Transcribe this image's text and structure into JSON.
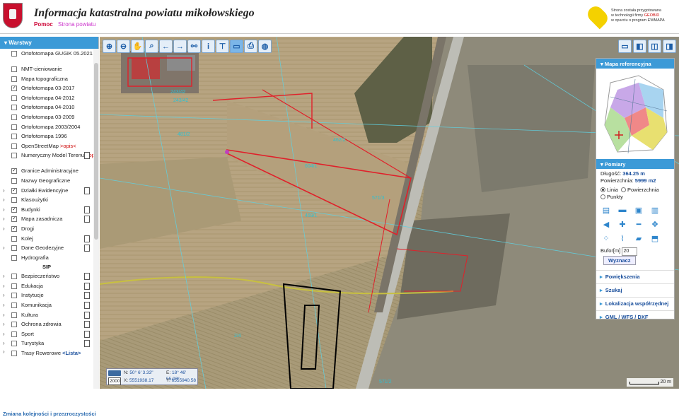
{
  "header": {
    "title": "Informacja katastralna powiatu mikołowskiego",
    "help_link": "Pomoc",
    "home_link": "Strona powiatu",
    "geobid_line1": "Strona została przygotowana",
    "geobid_line2a": "w technologii firmy ",
    "geobid_brand": "GEOBID",
    "geobid_line3": "w oparciu o program EWMAPA"
  },
  "layers_panel": {
    "title": "Warstwy",
    "items": [
      {
        "label": "Ortofotomapa GUGiK 05.2021",
        "checked": false,
        "expand": false,
        "doc": false,
        "two": true
      },
      {
        "label": "NMT-cieniowanie",
        "checked": false,
        "expand": false,
        "doc": false
      },
      {
        "label": "Mapa topograficzna",
        "checked": false,
        "expand": false,
        "doc": false
      },
      {
        "label": "Ortofotomapa 03-2017",
        "checked": true,
        "expand": false,
        "doc": false
      },
      {
        "label": "Ortofotomapa 04-2012",
        "checked": false,
        "expand": false,
        "doc": false
      },
      {
        "label": "Ortofotomapa 04-2010",
        "checked": false,
        "expand": false,
        "doc": false
      },
      {
        "label": "Ortofotomapa 03-2009",
        "checked": false,
        "expand": false,
        "doc": false
      },
      {
        "label": "Ortofotomapa 2003/2004",
        "checked": false,
        "expand": false,
        "doc": false
      },
      {
        "label": "Ortofotomapa 1996",
        "checked": false,
        "expand": false,
        "doc": false
      },
      {
        "label": "OpenStreetMap ",
        "opis": ">opis<",
        "checked": false,
        "expand": false,
        "doc": false
      },
      {
        "label": "Numeryczny Model Terenu ",
        "opis": ">opis<",
        "checked": false,
        "expand": false,
        "doc": true,
        "two": true
      },
      {
        "label": "Granice Administracyjne",
        "checked": true,
        "expand": false,
        "doc": false
      },
      {
        "label": "Nazwy Geograficzne",
        "checked": false,
        "expand": false,
        "doc": false
      },
      {
        "label": "Działki Ewidencyjne",
        "checked": true,
        "expand": true,
        "doc": true
      },
      {
        "label": "Klasoużytki",
        "checked": false,
        "expand": true,
        "doc": false
      },
      {
        "label": "Budynki",
        "checked": true,
        "expand": true,
        "doc": true
      },
      {
        "label": "Mapa zasadnicza",
        "checked": true,
        "expand": true,
        "doc": true
      },
      {
        "label": "Drogi",
        "checked": true,
        "expand": true,
        "doc": false
      },
      {
        "label": "Kolej",
        "checked": false,
        "expand": false,
        "doc": true
      },
      {
        "label": "Dane Geodezyjne",
        "checked": false,
        "expand": true,
        "doc": true
      },
      {
        "label": "Hydrografia",
        "checked": false,
        "expand": false,
        "doc": false
      }
    ],
    "group_label": "SIP",
    "sip_items": [
      {
        "label": "Bezpieczeństwo",
        "checked": false,
        "expand": true,
        "doc": true
      },
      {
        "label": "Edukacja",
        "checked": false,
        "expand": true,
        "doc": true
      },
      {
        "label": "Instytucje",
        "checked": false,
        "expand": true,
        "doc": true
      },
      {
        "label": "Komunikacja",
        "checked": false,
        "expand": true,
        "doc": true
      },
      {
        "label": "Kultura",
        "checked": false,
        "expand": true,
        "doc": true
      },
      {
        "label": "Ochrona zdrowia",
        "checked": false,
        "expand": true,
        "doc": true
      },
      {
        "label": "Sport",
        "checked": false,
        "expand": true,
        "doc": true
      },
      {
        "label": "Turystyka",
        "checked": false,
        "expand": true,
        "doc": true
      },
      {
        "label": "Trasy Rowerowe ",
        "lista": "<Lista>",
        "checked": false,
        "expand": true,
        "doc": false,
        "two": true
      }
    ],
    "changes_link": "Zmiana kolejności i przezroczystości"
  },
  "map": {
    "parcel_labels": [
      "243/42",
      "243/42",
      "462/2",
      "604/1",
      "571/3",
      "571/2",
      "481/2",
      "469/1",
      "2/4"
    ],
    "coords": {
      "n_label": "N:",
      "n_value": "50° 6' 3.33\"",
      "e_label": "E:",
      "e_value": "18° 46' 55.03\"",
      "x_label": "X:",
      "x_value": "5551938.17",
      "y_label": "Y:",
      "y_value": "6555940.58",
      "epoch": "2000"
    },
    "scale": "20 m"
  },
  "reference_map": {
    "title": "Mapa referencyjna"
  },
  "measurements": {
    "title": "Pomiary",
    "length_label": "Długość:",
    "length_value": "364.25 m",
    "area_label": "Powierzchnia:",
    "area_value": "5999 m2",
    "mode_line": "Linia",
    "mode_area": "Powierzchnia",
    "mode_points": "Punkty",
    "buffer_label": "Bufor[m]",
    "buffer_value": "20",
    "compute_button": "Wyznacz"
  },
  "accordion": [
    "Powiększenia",
    "Szukaj",
    "Lokalizacja współrzędnej",
    "GML / WFS / DXF"
  ],
  "icons": {
    "toolbar": [
      "zoom-in-icon",
      "zoom-out-icon",
      "pan-hand-icon",
      "zoom-box-icon",
      "back-arrow-icon",
      "forward-arrow-icon",
      "link-icon",
      "info-icon",
      "identify-icon",
      "measure-icon",
      "print-icon",
      "globe-icon"
    ],
    "view": [
      "window-layout-icon",
      "split-left-icon",
      "split-both-icon",
      "split-right-icon"
    ]
  }
}
